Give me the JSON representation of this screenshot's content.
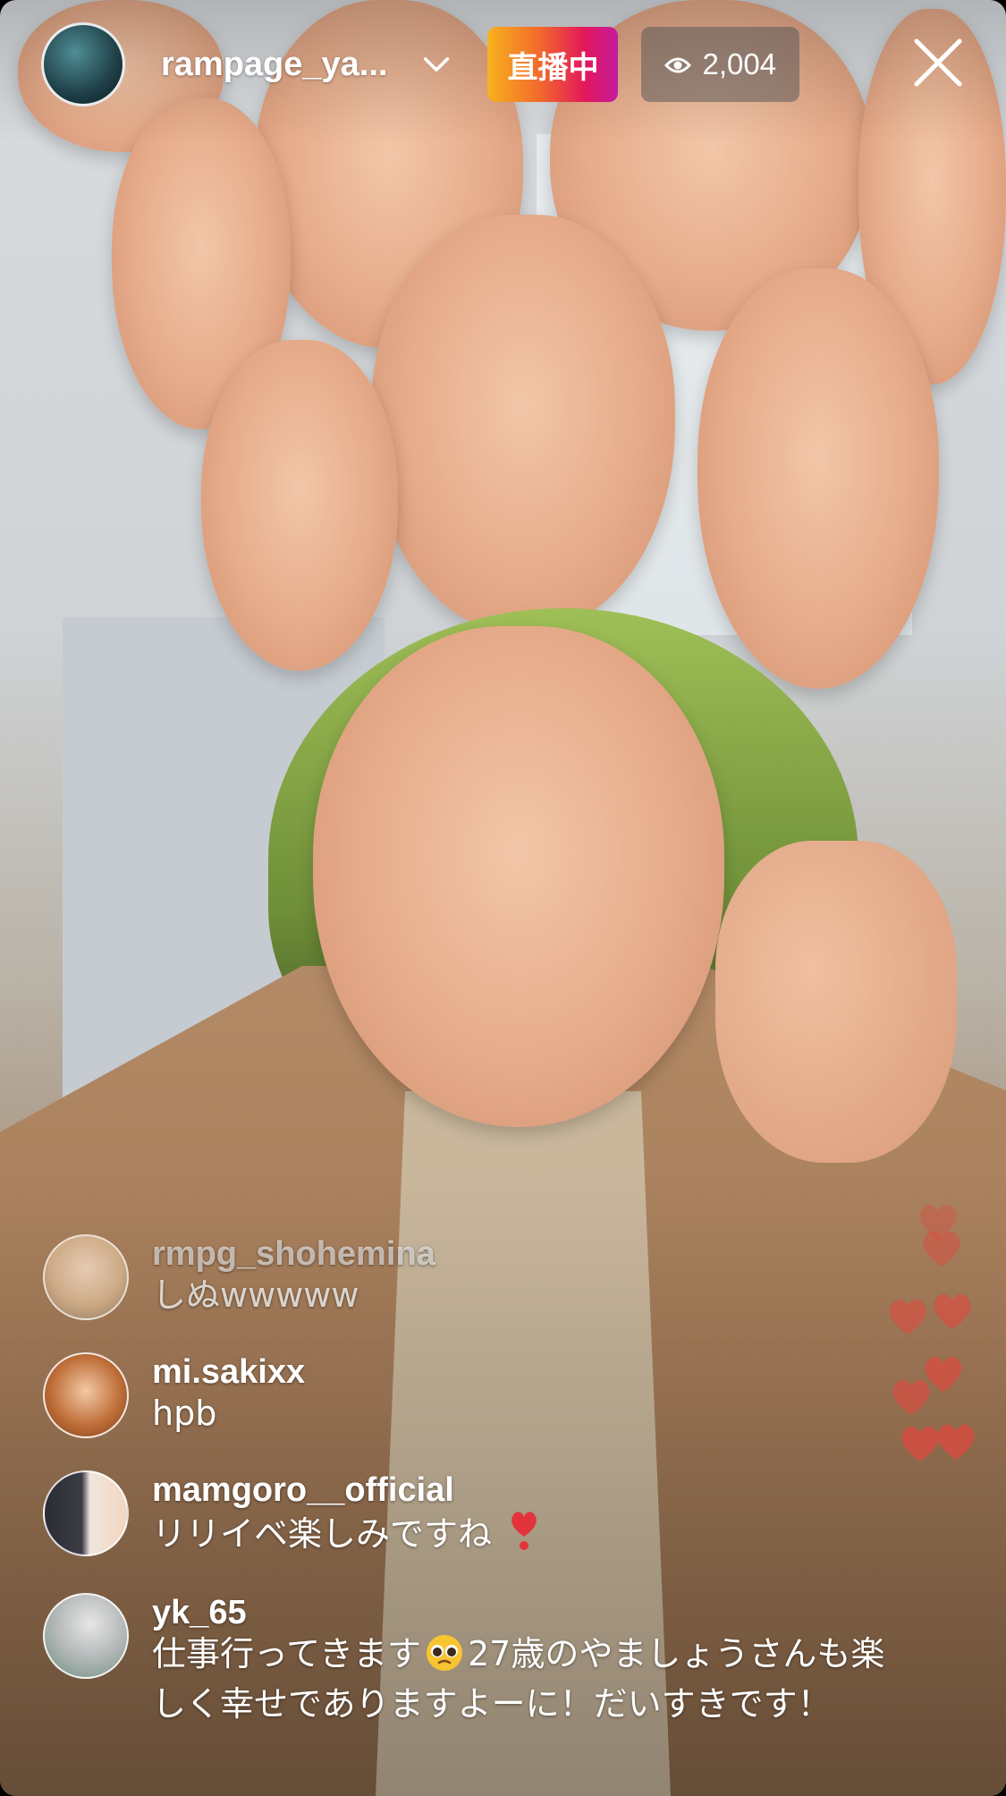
{
  "host": {
    "username": "rampage_ya...",
    "live_label": "直播中",
    "viewer_count": "2,004"
  },
  "icons": {
    "chevron": "chevron-down-icon",
    "eye": "eye-icon",
    "close": "close-icon",
    "heart": "heart-icon"
  },
  "colors": {
    "live_gradient": [
      "#f7b21e",
      "#f26a2c",
      "#e2175c",
      "#c41c9e"
    ],
    "heart": "#e4473f",
    "viewer_pill": "#5a5a5a"
  },
  "comments": [
    {
      "username": "rmpg_shohemina",
      "text": "しぬwwwww"
    },
    {
      "username": "mi.sakixx",
      "text": "hpb"
    },
    {
      "username": "mamgoro__official",
      "text": "リリイベ楽しみですね",
      "emoji": "heart-exclamation"
    },
    {
      "username": "yk_65",
      "text_before_emoji": "仕事行ってきます",
      "emoji": "pleading-face",
      "text_after_emoji": "27歳のやましょうさんも楽しく幸せでありますよーに！だいすきです！"
    }
  ]
}
